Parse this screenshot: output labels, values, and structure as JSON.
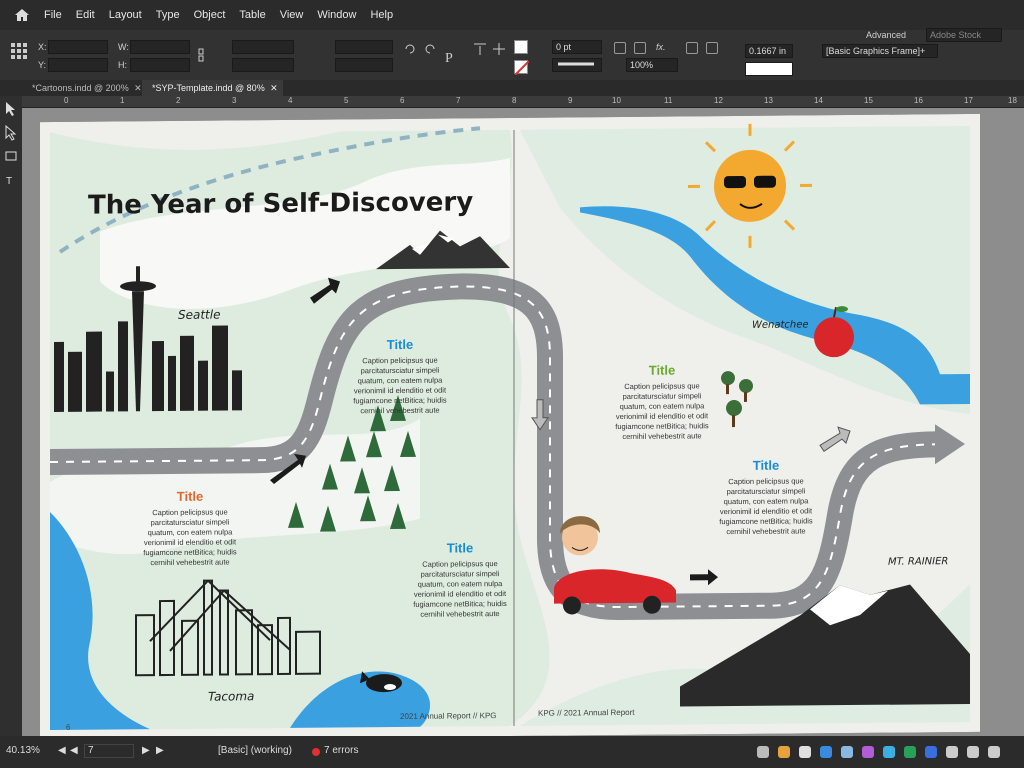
{
  "menubar": {
    "items": [
      "File",
      "Edit",
      "Layout",
      "Type",
      "Object",
      "Table",
      "View",
      "Window",
      "Help"
    ]
  },
  "controls": {
    "x_label": "X:",
    "y_label": "Y:",
    "w_label": "W:",
    "h_label": "H:",
    "stroke_weight": "0 pt",
    "zoom_pct": "100%",
    "dimension": "0.1667 in",
    "frame_style": "[Basic Graphics Frame]+",
    "workspace": "Advanced",
    "search_placeholder": "Adobe Stock"
  },
  "tabs": [
    {
      "label": "*Cartoons.indd @ 200%",
      "active": false
    },
    {
      "label": "*SYP-Template.indd @ 80%",
      "active": true
    }
  ],
  "ruler_ticks": [
    "0",
    "1",
    "2",
    "3",
    "4",
    "5",
    "6",
    "7",
    "8",
    "9",
    "10",
    "11",
    "12",
    "13",
    "14",
    "15",
    "16",
    "17",
    "18"
  ],
  "document": {
    "headline": "The Year of Self-Discovery",
    "places": {
      "seattle": "Seattle",
      "tacoma": "Tacoma",
      "wenatchee": "Wenatchee",
      "rainier": "MT. RAINIER"
    },
    "blocks": [
      {
        "title": "Title",
        "color": "#1a8ccf",
        "lines": [
          "Caption pelicipsus que",
          "parcitatursciatur simpeli",
          "quatum, con eatem nulpa",
          "verionimil id elenditio et odit",
          "fugiamcone netBitica; huidis",
          "cernihil vehebestrit aute"
        ]
      },
      {
        "title": "Title",
        "color": "#e2692d",
        "lines": [
          "Caption pelicipsus que",
          "parcitatursciatur simpeli",
          "quatum, con eatem nulpa",
          "verionimil id elenditio et odit",
          "fugiamcone netBitica; huidis",
          "cernihil vehebestrit aute"
        ]
      },
      {
        "title": "Title",
        "color": "#1a8ccf",
        "lines": [
          "Caption pelicipsus que",
          "parcitatursciatur simpeli",
          "quatum, con eatem nulpa",
          "verionimil id elenditio et odit",
          "fugiamcone netBitica; huidis",
          "cernihil vehebestrit aute"
        ]
      },
      {
        "title": "Title",
        "color": "#6aab2f",
        "lines": [
          "Caption pelicipsus que",
          "parcitatursciatur simpeli",
          "quatum, con eatem nulpa",
          "verionimil id elenditio et odit",
          "fugiamcone netBitica; huidis",
          "cernihil vehebestrit aute"
        ]
      },
      {
        "title": "Title",
        "color": "#1a8ccf",
        "lines": [
          "Caption pelicipsus que",
          "parcitatursciatur simpeli",
          "quatum, con eatem nulpa",
          "verionimil id elenditio et odit",
          "fugiamcone netBitica; huidis",
          "cernihil vehebestrit aute"
        ]
      }
    ],
    "footer_left": "2021 Annual Report // KPG",
    "footer_right": "KPG // 2021 Annual Report",
    "page_number": "6"
  },
  "status": {
    "zoom": "40.13%",
    "page": "7",
    "preflight_profile": "[Basic] (working)",
    "errors": "7 errors"
  },
  "colors": {
    "app_bg": "#2b2b2b",
    "page_bg": "#efefec",
    "land_green": "#cfe9d6",
    "water": "#3aa0df",
    "road": "#8d8f93",
    "error_dot": "#e03030"
  }
}
